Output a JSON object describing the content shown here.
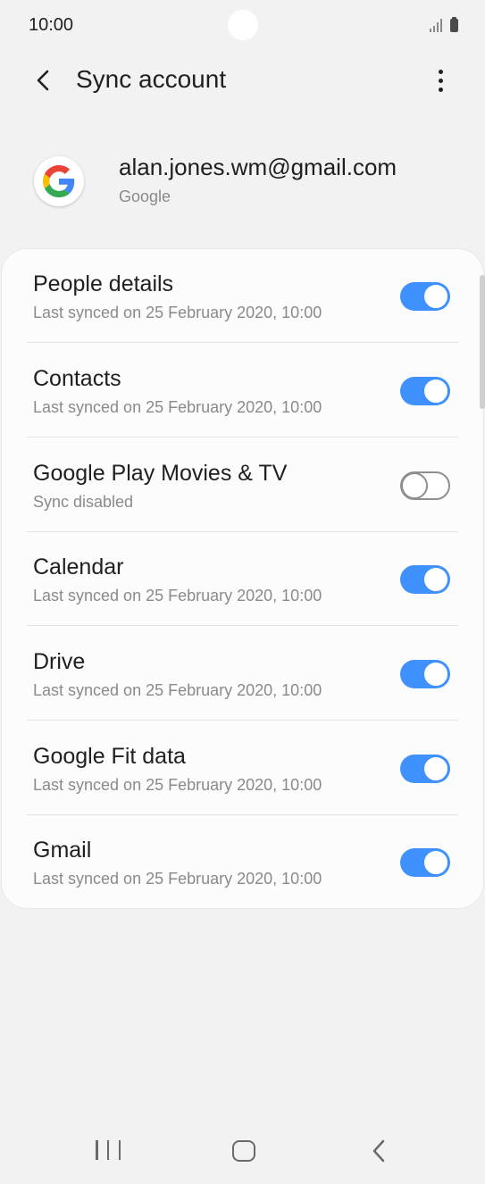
{
  "status_bar": {
    "time": "10:00"
  },
  "header": {
    "title": "Sync account"
  },
  "account": {
    "email": "alan.jones.wm@gmail.com",
    "type": "Google"
  },
  "sync_items": [
    {
      "title": "People details",
      "subtitle": "Last synced on 25 February 2020, 10:00",
      "enabled": true
    },
    {
      "title": "Contacts",
      "subtitle": "Last synced on 25 February 2020, 10:00",
      "enabled": true
    },
    {
      "title": "Google Play Movies & TV",
      "subtitle": "Sync disabled",
      "enabled": false
    },
    {
      "title": "Calendar",
      "subtitle": "Last synced on 25 February 2020, 10:00",
      "enabled": true
    },
    {
      "title": "Drive",
      "subtitle": "Last synced on 25 February 2020, 10:00",
      "enabled": true
    },
    {
      "title": "Google Fit data",
      "subtitle": "Last synced on 25 February 2020, 10:00",
      "enabled": true
    },
    {
      "title": "Gmail",
      "subtitle": "Last synced on 25 February 2020, 10:00",
      "enabled": true
    }
  ],
  "colors": {
    "accent": "#3e91ff",
    "background": "#f2f2f2",
    "card": "#fcfcfc"
  },
  "icons": {
    "back": "back-arrow-icon",
    "more": "more-options-icon",
    "logo": "google-logo-icon",
    "nav_recent": "recent-apps-icon",
    "nav_home": "home-icon",
    "nav_back": "nav-back-icon"
  }
}
